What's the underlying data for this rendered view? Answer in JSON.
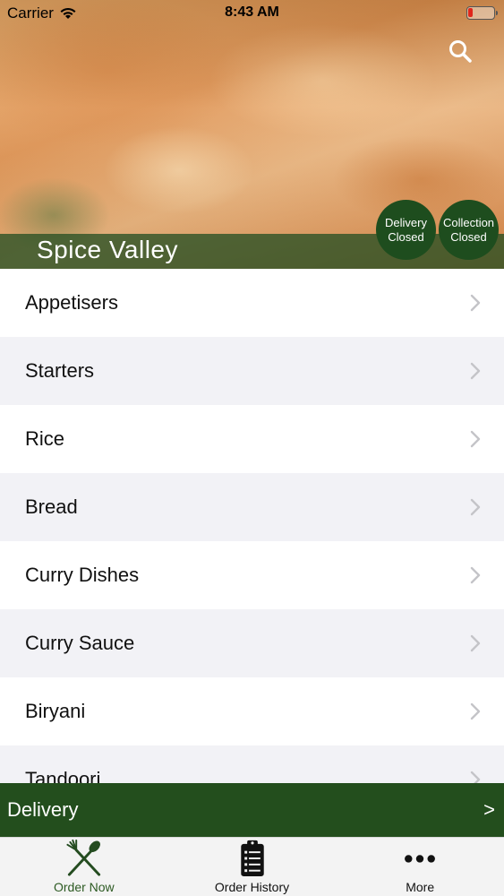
{
  "status_bar": {
    "carrier": "Carrier",
    "time": "8:43 AM"
  },
  "header": {
    "store_name": "Spice Valley",
    "badges": [
      {
        "line1": "Delivery",
        "line2": "Closed"
      },
      {
        "line1": "Collection",
        "line2": "Closed"
      }
    ]
  },
  "menu": {
    "categories": [
      {
        "label": "Appetisers"
      },
      {
        "label": "Starters"
      },
      {
        "label": "Rice"
      },
      {
        "label": "Bread"
      },
      {
        "label": "Curry Dishes"
      },
      {
        "label": "Curry Sauce"
      },
      {
        "label": "Biryani"
      },
      {
        "label": "Tandoori"
      }
    ]
  },
  "delivery_bar": {
    "label": "Delivery",
    "arrow": ">"
  },
  "tabs": [
    {
      "label": "Order Now",
      "icon": "fork-knife-icon",
      "active": true
    },
    {
      "label": "Order History",
      "icon": "clipboard-list-icon",
      "active": false
    },
    {
      "label": "More",
      "icon": "more-dots-icon",
      "active": false
    }
  ],
  "colors": {
    "brand_green": "#234e1d",
    "badge_green": "#1e4d1e",
    "active_tab": "#2c5a22"
  }
}
